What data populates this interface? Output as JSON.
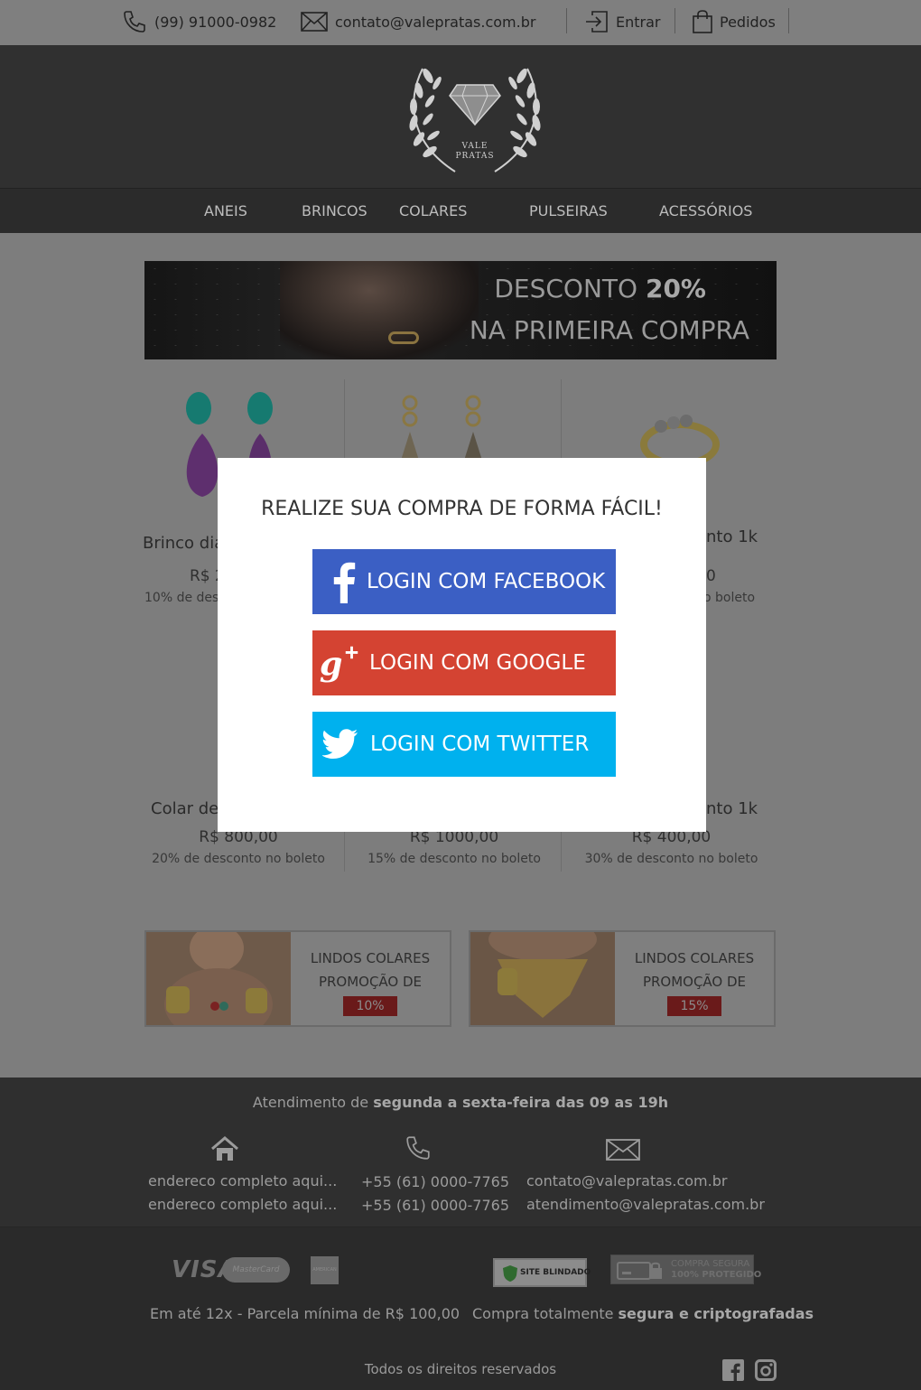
{
  "topbar": {
    "phone": "(99) 91000-0982",
    "email": "contato@valepratas.com.br",
    "login": "Entrar",
    "orders": "Pedidos"
  },
  "header": {
    "logo_line1": "VALE",
    "logo_line2": "PRATAS"
  },
  "nav": [
    "ANEIS",
    "BRINCOS",
    "COLARES",
    "PULSEIRAS",
    "ACESSÓRIOS"
  ],
  "banner": {
    "line1_prefix": "DESCONTO ",
    "line1_bold": "20%",
    "line2": "NA PRIMEIRA COMPRA"
  },
  "products_row1": [
    {
      "name": "Brinco dia",
      "price": "R$ 2",
      "discount": "10% de desco"
    },
    {
      "name": "nto 1k",
      "price": "0",
      "discount": "o boleto"
    }
  ],
  "products_row2": [
    {
      "name": "Colar de",
      "price": "R$ 800,00",
      "discount": "20% de desconto no boleto"
    },
    {
      "name": "",
      "price": "R$ 1000,00",
      "discount": "15% de desconto no boleto"
    },
    {
      "name": "nto 1k",
      "price": "R$ 400,00",
      "discount": "30% de desconto no boleto"
    }
  ],
  "promos": [
    {
      "line1": "LINDOS COLARES",
      "line2": "PROMOÇÃO DE",
      "pct": "10%"
    },
    {
      "line1": "LINDOS COLARES",
      "line2": "PROMOÇÃO DE",
      "pct": "15%"
    }
  ],
  "footer": {
    "hours_prefix": "Atendimento de ",
    "hours_bold": "segunda a sexta-feira das 09 as 19h",
    "address1": "endereco completo aqui...",
    "address2": "endereco completo aqui...",
    "phone1": "+55 (61) 0000-7765",
    "phone2": "+55 (61) 0000-7765",
    "email1": "contato@valepratas.com.br",
    "email2": "atendimento@valepratas.com.br",
    "visa": "VISA",
    "mastercard": "MasterCard",
    "amex": "AMERICAN EXPRESS",
    "installments": "Em até 12x - Parcela mínima de R$ 100,00",
    "secure_prefix": "Compra totalmente ",
    "secure_bold": "segura e criptografadas",
    "site_blindado": "SITE BLINDADO",
    "secure_badge1": "COMPRA SEGURA",
    "secure_badge2": "100% PROTEGIDO",
    "rights": "Todos os direitos reservados"
  },
  "modal": {
    "title": "REALIZE SUA COMPRA DE FORMA FÁCIL!",
    "facebook": "LOGIN COM FACEBOOK",
    "google": "LOGIN COM GOOGLE",
    "twitter": "LOGIN COM TWITTER"
  }
}
